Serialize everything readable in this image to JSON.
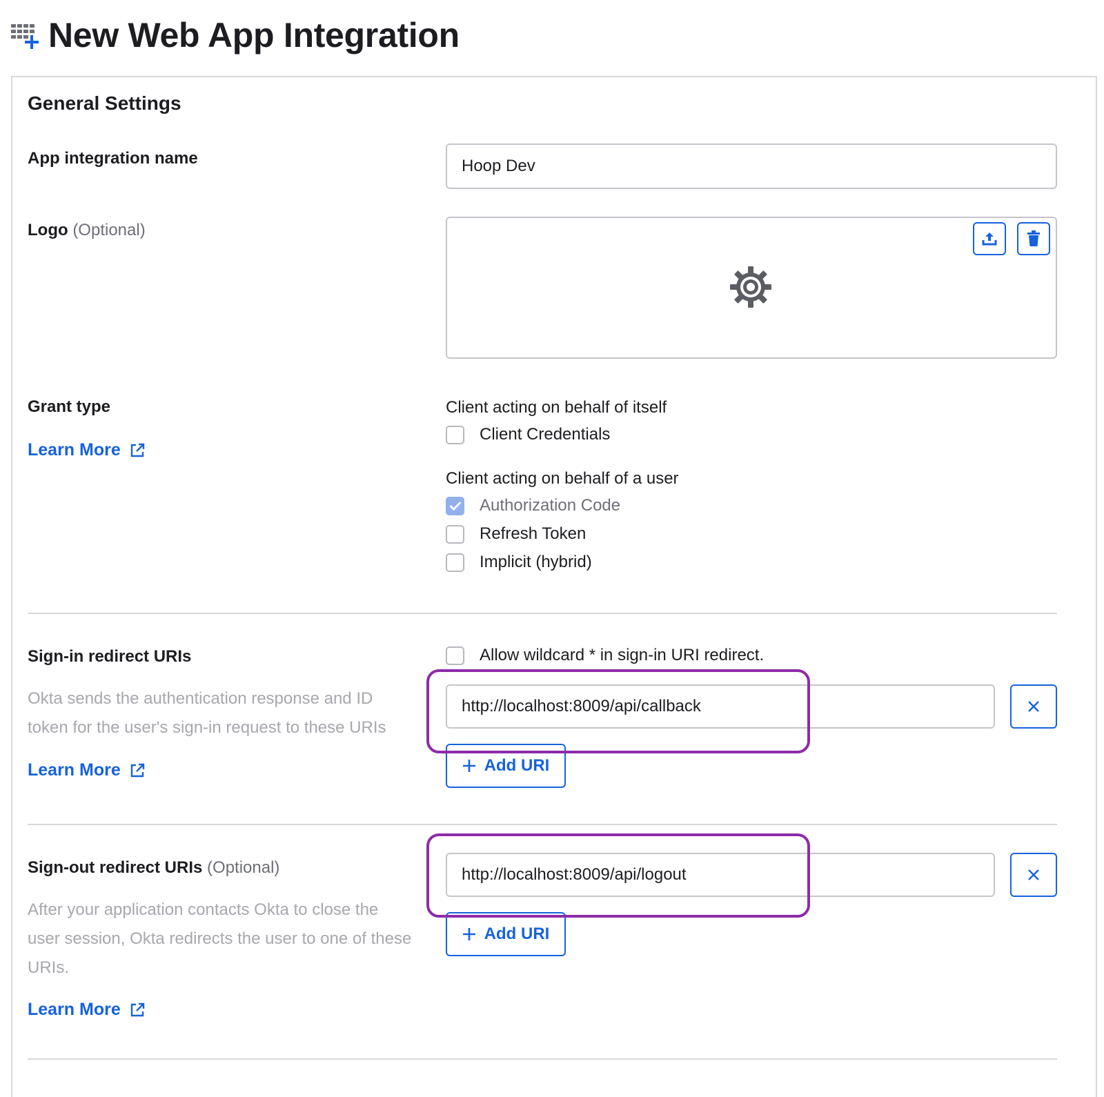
{
  "page": {
    "title": "New Web App Integration",
    "icon": "grid-add-icon"
  },
  "general_settings": {
    "heading": "General Settings",
    "app_name": {
      "label": "App integration name",
      "value": "Hoop Dev"
    },
    "logo": {
      "label": "Logo",
      "optional": "(Optional)",
      "placeholder_icon": "gear-icon",
      "upload_icon": "upload-icon",
      "delete_icon": "trash-icon"
    },
    "grant_type": {
      "label": "Grant type",
      "learn_more": "Learn More",
      "group_self": "Client acting on behalf of itself",
      "group_user": "Client acting on behalf of a user",
      "options": [
        {
          "label": "Client Credentials",
          "checked": false,
          "disabled": false
        },
        {
          "label": "Authorization Code",
          "checked": true,
          "disabled": true
        },
        {
          "label": "Refresh Token",
          "checked": false,
          "disabled": false
        },
        {
          "label": "Implicit (hybrid)",
          "checked": false,
          "disabled": false
        }
      ]
    },
    "sign_in": {
      "label": "Sign-in redirect URIs",
      "help": "Okta sends the authentication response and ID token for the user's sign-in request to these URIs",
      "learn_more": "Learn More",
      "wildcard_label": "Allow wildcard * in sign-in URI redirect.",
      "wildcard_checked": false,
      "uri_value": "http://localhost:8009/api/callback",
      "add_label": "Add URI"
    },
    "sign_out": {
      "label": "Sign-out redirect URIs",
      "optional": "(Optional)",
      "help": "After your application contacts Okta to close the user session, Okta redirects the user to one of these URIs.",
      "learn_more": "Learn More",
      "uri_value": "http://localhost:8009/api/logout",
      "add_label": "Add URI"
    }
  },
  "colors": {
    "link": "#1662dd",
    "annotation": "#8e2ba8",
    "checked_disabled": "#93b0eb"
  }
}
